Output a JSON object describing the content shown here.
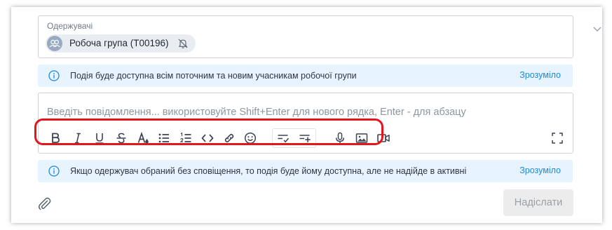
{
  "recipients": {
    "label": "Одержувачі",
    "chip": {
      "text": "Робоча група (T00196)",
      "avatar_icon": "group-icon",
      "status_icon": "bell-off-icon"
    }
  },
  "notice_top": {
    "icon": "info-icon",
    "text": "Подія буде доступна всім поточним та новим учасникам робочої групи",
    "action": "Зрозуміло"
  },
  "composer": {
    "placeholder": "Введіть повідомлення... використовуйте Shift+Enter для нового рядка, Enter - для абзацу",
    "toolbar": [
      "bold-icon",
      "italic-icon",
      "underline-icon",
      "strikethrough-icon",
      "text-color-icon",
      "bullet-list-icon",
      "numbered-list-icon",
      "code-icon",
      "link-icon",
      "emoji-icon",
      "task-check-icon",
      "task-add-icon",
      "microphone-icon",
      "image-icon",
      "video-icon"
    ],
    "expand_icon": "fullscreen-icon"
  },
  "notice_bottom": {
    "icon": "info-icon",
    "text": "Якщо одержувач обраний без сповіщення, то подія буде йому доступна, але не надійде в активні",
    "action": "Зрозуміло"
  },
  "footer": {
    "attach_icon": "paperclip-icon",
    "send_label": "Надіслати"
  },
  "colors": {
    "accent": "#1b8ae0",
    "notice_bg": "#e7f4fd",
    "highlight": "#e3151d",
    "icon": "#3b4452"
  }
}
